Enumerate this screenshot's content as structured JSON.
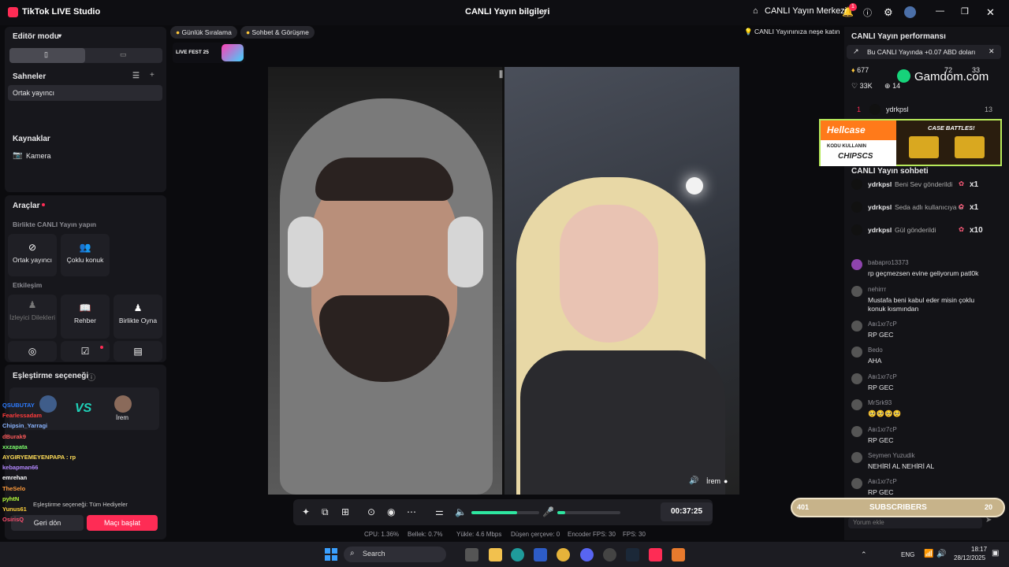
{
  "title_bar": {
    "app_name": "TikTok LIVE Studio",
    "center_title": "CANLI Yayın bilgileri",
    "live_center": "CANLI Yayın Merkezi",
    "notification_count": "1"
  },
  "left_panel": {
    "editor_mode": "Editör modu",
    "scenes_title": "Sahneler",
    "scene_item": "Ortak yayıncı",
    "sources_title": "Kaynaklar",
    "source_camera": "Kamera",
    "tools_title": "Araçlar",
    "together_live": "Birlikte CANLI Yayın yapın",
    "tool_cohost": "Ortak yayıncı",
    "tool_multi_guest": "Çoklu konuk",
    "interaction": "Etkileşim",
    "tool_viewer_requests": "İzleyici Dilekleri",
    "tool_guide": "Rehber",
    "tool_play_together": "Birlikte Oyna",
    "match_option": "Eşleştirme seçeneği",
    "match_right_name": "İrem",
    "match_filter": "Eşleştirme seçeneği: Tüm Hediyeler",
    "back_button": "Geri dön",
    "start_match_button": "Maçı başlat"
  },
  "top_chips": {
    "daily_ranking": "Günlük Sıralama",
    "chat_meet": "Sohbet & Görüşme",
    "fun_tip": "CANLI Yayınınıza neşe katın",
    "live_fest": "LIVE FEST 25"
  },
  "stage": {
    "guest_name": "İrem"
  },
  "controls": {
    "timer": "00:37:25"
  },
  "stats": {
    "cpu": "CPU: 1.36%",
    "memory": "Bellek: 0.7%",
    "upload": "Yükle: 4.6 Mbps",
    "dropped": "Düşen çerçeve: 0",
    "encoder_fps": "Encoder FPS: 30",
    "fps": "FPS: 30"
  },
  "right_panel": {
    "performance_title": "CANLI Yayın performansı",
    "earnings_note": "Bu CANLI Yayında +0.07 ABD doları",
    "stat_diamonds": "677",
    "stat_likes": "33K",
    "stat_gifts": "14",
    "stat_partial_1": "72",
    "stat_partial_2": "33",
    "top_gifter_rank": "1",
    "top_gifter_name": "ydrkpsl",
    "top_gifter_count": "13",
    "chat_title": "CANLI Yayın sohbeti",
    "gift_rows": [
      {
        "user": "ydrkpsl",
        "text": "Beni Sev gönderildi",
        "count": "x1"
      },
      {
        "user": "ydrkpsl",
        "text": "Seda adlı kullanıcıya G",
        "count": "x1"
      },
      {
        "user": "ydrkpsl",
        "text": "Gül gönderildi",
        "count": "x10"
      }
    ],
    "chat_messages": [
      {
        "user": "babapro13373",
        "text": "rp geçmezsen evine geliyorum patl0k"
      },
      {
        "user": "nehirrr",
        "text": "Mustafa beni kabul eder misin çoklu konuk kısmından"
      },
      {
        "user": "Aвı1xr7cP",
        "text": "RP GEC"
      },
      {
        "user": "Bedo",
        "text": "AHA"
      },
      {
        "user": "Aвı1xr7cP",
        "text": "RP GEC"
      },
      {
        "user": "MrSrk93",
        "text": "🥺🥺🥺🥺"
      },
      {
        "user": "Aвı1xr7cP",
        "text": "RP GEC"
      },
      {
        "user": "Seymen Yuzudik",
        "text": "NEHİRİ AL NEHİRİ AL"
      },
      {
        "user": "Aвı1xr7cP",
        "text": "RP GEC"
      }
    ],
    "comment_placeholder": "Yorum ekle"
  },
  "overlays": {
    "gamdom": "Gamdom.com",
    "hellcase": "Hellcase",
    "hellcase_code_label": "KODU KULLANIN",
    "hellcase_code": "CHIPSCS",
    "case_battles": "CASE BATTLES!",
    "subs_left": "401",
    "subs_label": "SUBSCRIBERS",
    "subs_right": "20",
    "overlay_chat": [
      {
        "user": "QSUBUTAY",
        "color": "#2d7cff"
      },
      {
        "user": "Fearlessadam",
        "color": "#ff3b3b"
      },
      {
        "user": "Chipsin_Yarragi",
        "color": "#8ab4ff"
      },
      {
        "user": "dBurak9",
        "color": "#ff5b5b"
      },
      {
        "user": "xxzapata",
        "color": "#7cff6b"
      },
      {
        "user": "AYGIRYEMEYENPAPA : rp",
        "color": "#ffdd57"
      },
      {
        "user": "kebapman66",
        "color": "#b388ff"
      },
      {
        "user": "emrehan",
        "color": "#ffffff"
      },
      {
        "user": "TheSelo",
        "color": "#ff9b3b"
      },
      {
        "user": "pyhtN",
        "color": "#b6ff3b"
      },
      {
        "user": "Yunus61",
        "color": "#ffd23b"
      },
      {
        "user": "OsirisQ",
        "color": "#ff4f6f"
      }
    ]
  },
  "taskbar": {
    "search": "Search",
    "lang": "ENG",
    "time": "18:17",
    "date": "28/12/2025"
  }
}
